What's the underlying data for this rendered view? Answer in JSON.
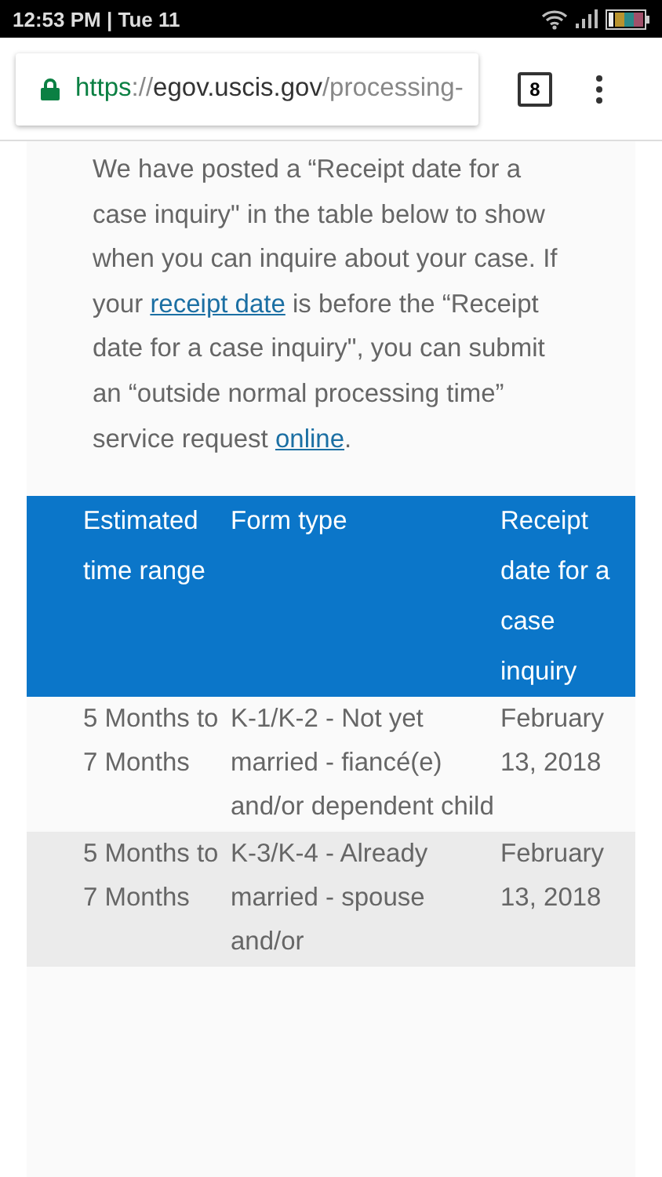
{
  "status_bar": {
    "time": "12:53 PM | Tue 11"
  },
  "browser": {
    "url_parts": [
      {
        "text": "https",
        "kind": "scheme"
      },
      {
        "text": "://",
        "kind": "sep"
      },
      {
        "text": "egov.uscis.gov",
        "kind": "host"
      },
      {
        "text": "/processing-",
        "kind": "path"
      }
    ],
    "tab_count": "8"
  },
  "intro": [
    {
      "kind": "text",
      "text": "We have posted a “Receipt date for a case inquiry\" in the table below to show when you can inquire about your case. If your "
    },
    {
      "kind": "link",
      "text": "receipt date"
    },
    {
      "kind": "text",
      "text": " is before the “Receipt date for a case inquiry\", you can submit an “outside normal processing time” service request "
    },
    {
      "kind": "link",
      "text": "online"
    },
    {
      "kind": "text",
      "text": "."
    }
  ],
  "table": {
    "columns": [
      "Estimated time range",
      "Form type",
      "Receipt date for a case inquiry"
    ],
    "rows": [
      {
        "cells": [
          "5 Months to 7 Months",
          "K-1/K-2 - Not yet married - fiancé(e) and/or dependent child",
          "February 13, 2018"
        ]
      },
      {
        "cells": [
          "5 Months to 7 Months",
          "K-3/K-4 - Already married - spouse and/or",
          "February 13, 2018"
        ]
      }
    ]
  }
}
